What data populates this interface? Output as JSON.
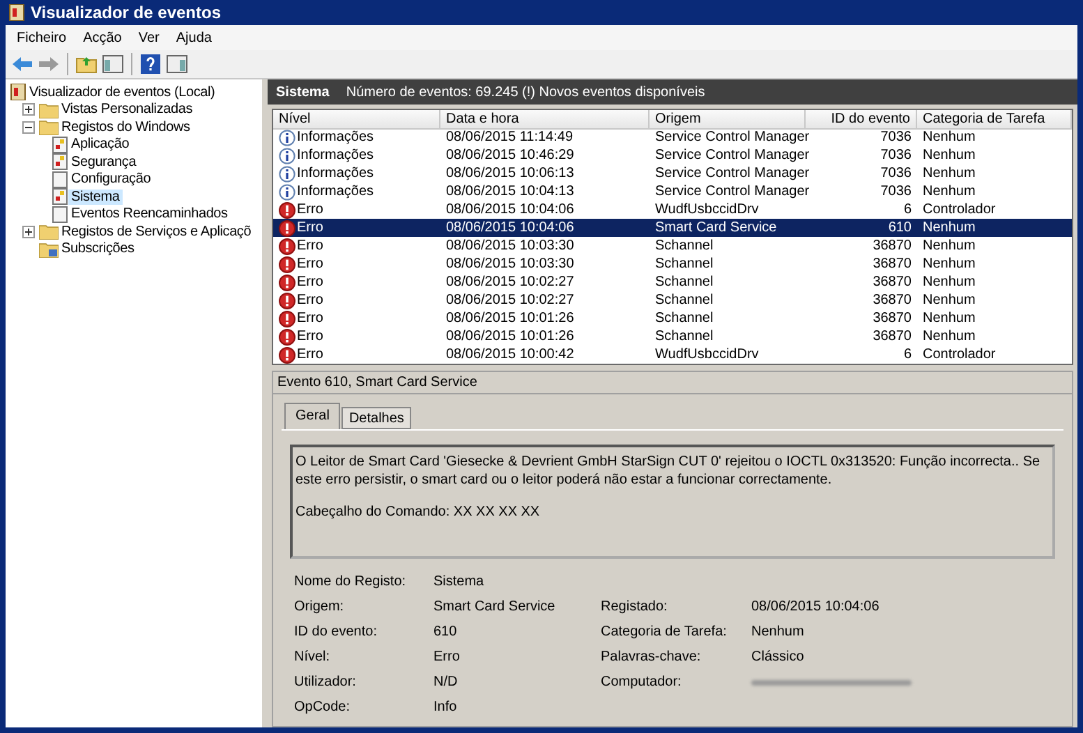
{
  "window": {
    "title": "Visualizador de eventos"
  },
  "menu": [
    "Ficheiro",
    "Acção",
    "Ver",
    "Ajuda"
  ],
  "tree": [
    {
      "label": "Visualizador de eventos (Local)",
      "kind": "root",
      "selected": false,
      "children": [
        {
          "label": "Vistas Personalizadas",
          "kind": "folder",
          "expanded": false,
          "selected": false
        },
        {
          "label": "Registos do Windows",
          "kind": "folder",
          "expanded": true,
          "selected": false,
          "children": [
            {
              "label": "Aplicação",
              "kind": "log",
              "selected": false
            },
            {
              "label": "Segurança",
              "kind": "log",
              "selected": false
            },
            {
              "label": "Configuração",
              "kind": "empty",
              "selected": false
            },
            {
              "label": "Sistema",
              "kind": "log",
              "selected": true
            },
            {
              "label": "Eventos Reencaminhados",
              "kind": "empty",
              "selected": false
            }
          ]
        },
        {
          "label": "Registos de Serviços e Aplicaçõ",
          "kind": "folder",
          "expanded": false,
          "selected": false
        },
        {
          "label": "Subscrições",
          "kind": "subscription",
          "selected": false
        }
      ]
    }
  ],
  "log_header": {
    "title": "Sistema",
    "info": "Número de eventos: 69.245 (!) Novos eventos disponíveis"
  },
  "table": {
    "columns": [
      "Nível",
      "Data e hora",
      "Origem",
      "ID do evento",
      "Categoria de Tarefa"
    ],
    "rows": [
      {
        "kind": "info",
        "level": "Informações",
        "date": "08/06/2015 11:14:49",
        "source": "Service Control Manager",
        "id": "7036",
        "category": "Nenhum",
        "selected": false
      },
      {
        "kind": "info",
        "level": "Informações",
        "date": "08/06/2015 10:46:29",
        "source": "Service Control Manager",
        "id": "7036",
        "category": "Nenhum",
        "selected": false
      },
      {
        "kind": "info",
        "level": "Informações",
        "date": "08/06/2015 10:06:13",
        "source": "Service Control Manager",
        "id": "7036",
        "category": "Nenhum",
        "selected": false
      },
      {
        "kind": "info",
        "level": "Informações",
        "date": "08/06/2015 10:04:13",
        "source": "Service Control Manager",
        "id": "7036",
        "category": "Nenhum",
        "selected": false
      },
      {
        "kind": "error",
        "level": "Erro",
        "date": "08/06/2015 10:04:06",
        "source": "WudfUsbccidDrv",
        "id": "6",
        "category": "Controlador",
        "selected": false
      },
      {
        "kind": "error",
        "level": "Erro",
        "date": "08/06/2015 10:04:06",
        "source": "Smart Card Service",
        "id": "610",
        "category": "Nenhum",
        "selected": true
      },
      {
        "kind": "error",
        "level": "Erro",
        "date": "08/06/2015 10:03:30",
        "source": "Schannel",
        "id": "36870",
        "category": "Nenhum",
        "selected": false
      },
      {
        "kind": "error",
        "level": "Erro",
        "date": "08/06/2015 10:03:30",
        "source": "Schannel",
        "id": "36870",
        "category": "Nenhum",
        "selected": false
      },
      {
        "kind": "error",
        "level": "Erro",
        "date": "08/06/2015 10:02:27",
        "source": "Schannel",
        "id": "36870",
        "category": "Nenhum",
        "selected": false
      },
      {
        "kind": "error",
        "level": "Erro",
        "date": "08/06/2015 10:02:27",
        "source": "Schannel",
        "id": "36870",
        "category": "Nenhum",
        "selected": false
      },
      {
        "kind": "error",
        "level": "Erro",
        "date": "08/06/2015 10:01:26",
        "source": "Schannel",
        "id": "36870",
        "category": "Nenhum",
        "selected": false
      },
      {
        "kind": "error",
        "level": "Erro",
        "date": "08/06/2015 10:01:26",
        "source": "Schannel",
        "id": "36870",
        "category": "Nenhum",
        "selected": false
      },
      {
        "kind": "error",
        "level": "Erro",
        "date": "08/06/2015 10:00:42",
        "source": "WudfUsbccidDrv",
        "id": "6",
        "category": "Controlador",
        "selected": false
      }
    ]
  },
  "detail": {
    "title": "Evento 610, Smart Card Service",
    "tabs": [
      {
        "label": "Geral",
        "selected": true
      },
      {
        "label": "Detalhes",
        "selected": false
      }
    ],
    "message": [
      "O Leitor de Smart Card 'Giesecke & Devrient GmbH StarSign CUT 0' rejeitou o IOCTL 0x313520: Função incorrecta.. Se este erro persistir, o smart card ou o leitor poderá não estar a funcionar correctamente.",
      "Cabeçalho do Comando: XX XX XX XX"
    ],
    "fields": [
      [
        {
          "label": "Nome do Registo:",
          "value": "Sistema"
        }
      ],
      [
        {
          "label": "Origem:",
          "value": "Smart Card Service"
        },
        {
          "label": "Registado:",
          "value": "08/06/2015 10:04:06"
        }
      ],
      [
        {
          "label": "ID do evento:",
          "value": "610"
        },
        {
          "label": "Categoria de Tarefa:",
          "value": "Nenhum"
        }
      ],
      [
        {
          "label": "Nível:",
          "value": "Erro"
        },
        {
          "label": "Palavras-chave:",
          "value": "Clássico"
        }
      ],
      [
        {
          "label": "Utilizador:",
          "value": "N/D"
        },
        {
          "label": "Computador:",
          "redacted": true
        }
      ],
      [
        {
          "label": "OpCode:",
          "value": "Info"
        }
      ]
    ]
  }
}
